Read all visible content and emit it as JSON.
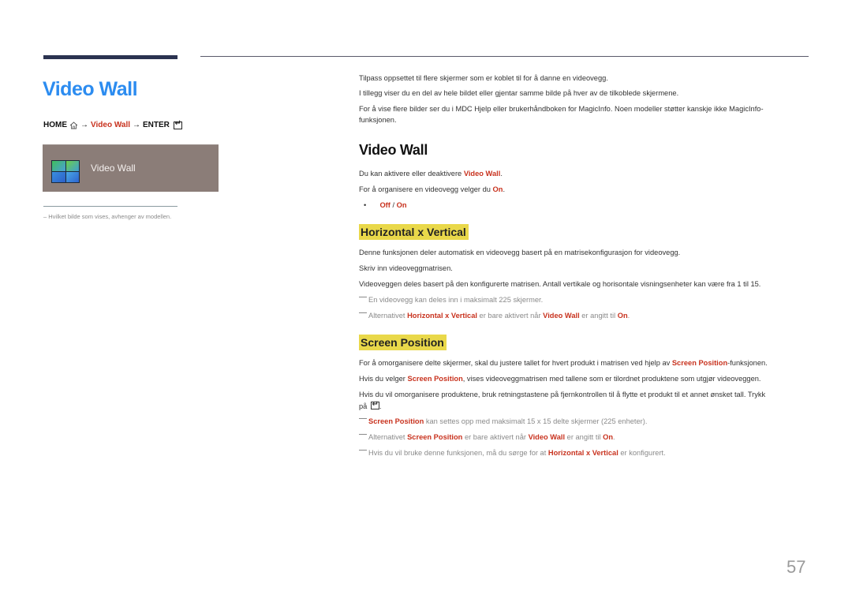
{
  "page_title": "Video Wall",
  "breadcrumb": {
    "home": "HOME",
    "arrow": "→",
    "item": "Video Wall",
    "enter": "ENTER",
    "home_icon": "home-icon",
    "enter_icon": "enter-icon"
  },
  "menu_card": {
    "label": "Video Wall",
    "icon": "video-wall-icon"
  },
  "left_note": "Hvilket bilde som vises, avhenger av modellen.",
  "left_note_prefix": "–",
  "intro": [
    "Tilpass oppsettet til flere skjermer som er koblet til for å danne en videovegg.",
    "I tillegg viser du en del av hele bildet eller gjentar samme bilde på hver av de tilkoblede skjermene.",
    "For å vise flere bilder ser du i MDC Hjelp eller brukerhåndboken for MagicInfo. Noen modeller støtter kanskje ikke MagicInfo-funksjonen."
  ],
  "section_video_wall": {
    "title": "Video Wall",
    "line1_pre": "Du kan aktivere eller deaktivere ",
    "line1_hl": "Video Wall",
    "line1_post": ".",
    "line2_pre": "For å organisere en videovegg velger du ",
    "line2_hl": "On",
    "line2_post": ".",
    "bullet": "•",
    "option_off": "Off",
    "option_sep": " / ",
    "option_on": "On"
  },
  "section_hv": {
    "title": "Horizontal x Vertical",
    "p1": "Denne funksjonen deler automatisk en videovegg basert på en matrisekonfigurasjon for videovegg.",
    "p2": "Skriv inn videoveggmatrisen.",
    "p3": "Videoveggen deles basert på den konfigurerte matrisen. Antall vertikale og horisontale visningsenheter kan være fra 1 til 15.",
    "note1": "En videovegg kan deles inn i maksimalt 225 skjermer.",
    "note2_pre": "Alternativet ",
    "note2_hl1": "Horizontal x Vertical",
    "note2_mid": " er bare aktivert når ",
    "note2_hl2": "Video Wall",
    "note2_mid2": " er angitt til ",
    "note2_hl3": "On",
    "note2_post": "."
  },
  "section_sp": {
    "title": "Screen Position",
    "p1_pre": "For å omorganisere delte skjermer, skal du justere tallet for hvert produkt i matrisen ved hjelp av ",
    "p1_hl": "Screen Position",
    "p1_post": "-funksjonen.",
    "p2_pre": "Hvis du velger ",
    "p2_hl": "Screen Position",
    "p2_post": ", vises videoveggmatrisen med tallene som er tilordnet produktene som utgjør videoveggen.",
    "p3_line1": "Hvis du vil omorganisere produktene, bruk retningstastene på fjernkontrollen til å flytte et produkt til et annet ønsket tall. Trykk",
    "p3_line2_pre": "på ",
    "p3_line2_post": ".",
    "note1_hl": "Screen Position",
    "note1_post": " kan settes opp med maksimalt 15 x 15 delte skjermer (225 enheter).",
    "note2_pre": "Alternativet ",
    "note2_hl1": "Screen Position",
    "note2_mid": " er bare aktivert når ",
    "note2_hl2": "Video Wall",
    "note2_mid2": " er angitt til ",
    "note2_hl3": "On",
    "note2_post": ".",
    "note3_pre": "Hvis du vil bruke denne funksjonen, må du sørge for at ",
    "note3_hl": "Horizontal x Vertical",
    "note3_post": " er konfigurert."
  },
  "page_number": "57",
  "colors": {
    "title_blue": "#2c8cf0",
    "highlight_red": "#c8321e",
    "section_highlight": "#e9d84a",
    "menu_card_bg": "#8b7d78",
    "top_bar": "#2b3350"
  }
}
